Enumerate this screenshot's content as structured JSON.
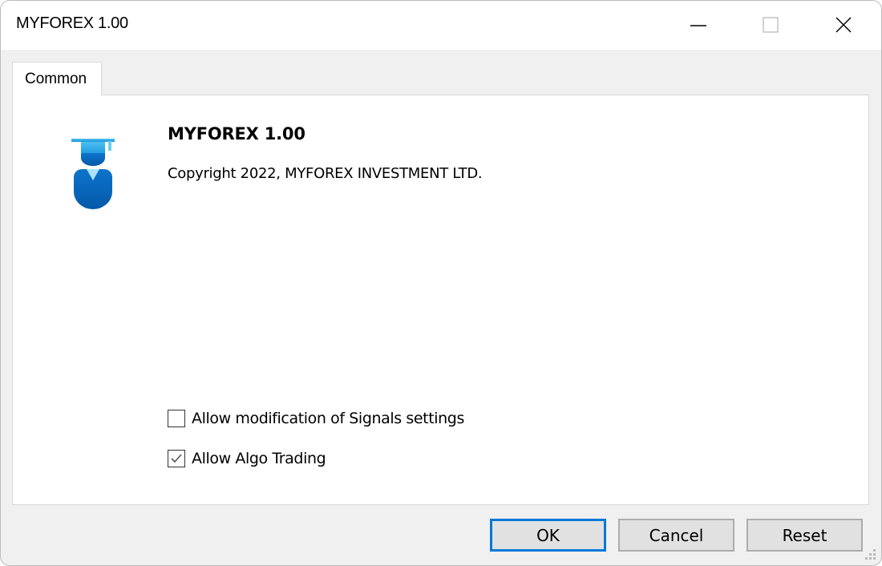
{
  "window": {
    "title": "MYFOREX 1.00",
    "controls": {
      "minimize": "minimize-icon",
      "maximize": "maximize-icon",
      "close": "close-icon"
    }
  },
  "tabs": [
    {
      "label": "Common",
      "active": true
    }
  ],
  "panel": {
    "icon": "graduate-user-icon",
    "app_name": "MYFOREX 1.00",
    "copyright": "Copyright 2022, MYFOREX INVESTMENT LTD.",
    "checkboxes": [
      {
        "label": "Allow modification of Signals settings",
        "checked": false
      },
      {
        "label": "Allow Algo Trading",
        "checked": true
      }
    ]
  },
  "buttons": {
    "ok": "OK",
    "cancel": "Cancel",
    "reset": "Reset"
  },
  "colors": {
    "accent": "#0078d7",
    "icon_blue": "#0a6fc7",
    "icon_light": "#3fb3ea"
  }
}
